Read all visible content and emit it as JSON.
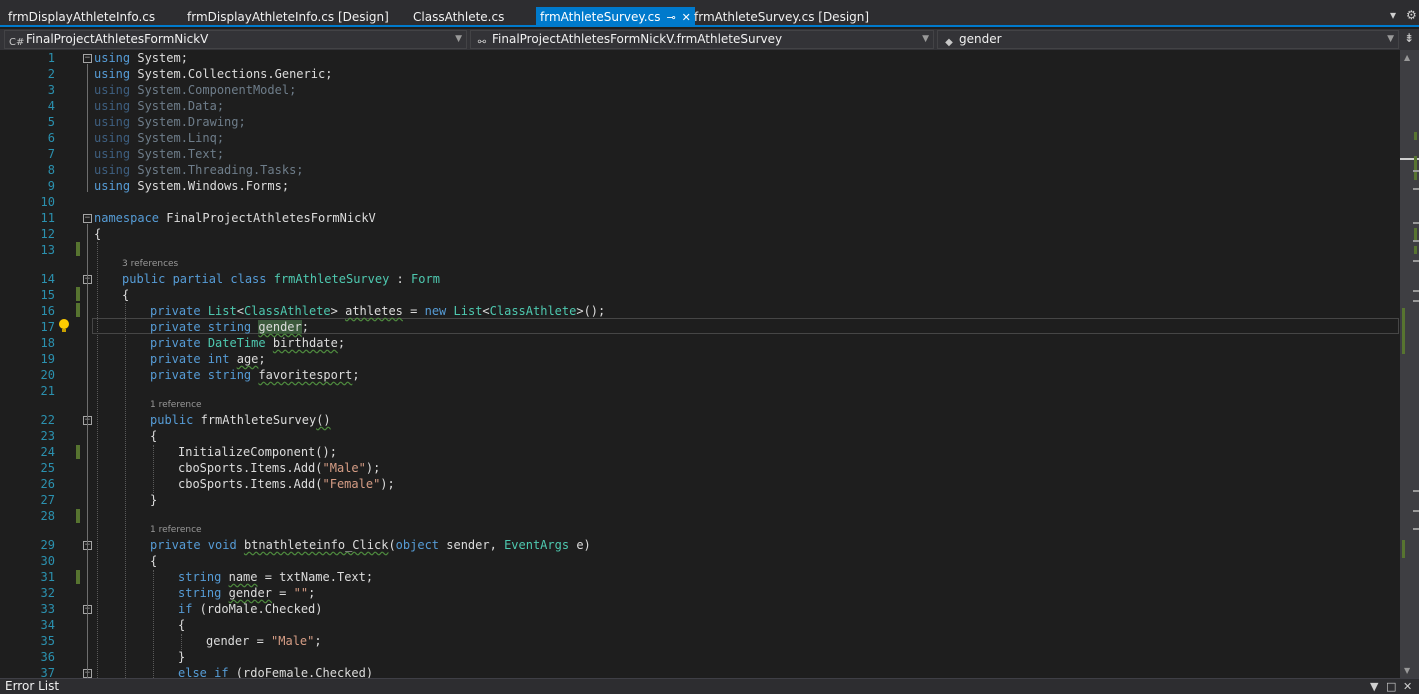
{
  "tabs": [
    {
      "label": "frmDisplayAthleteInfo.cs",
      "active": false
    },
    {
      "label": "frmDisplayAthleteInfo.cs [Design]",
      "active": false
    },
    {
      "label": "ClassAthlete.cs",
      "active": false
    },
    {
      "label": "frmAthleteSurvey.cs",
      "active": true
    },
    {
      "label": "frmAthleteSurvey.cs [Design]",
      "active": false
    }
  ],
  "nav": {
    "project": "FinalProjectAthletesFormNickV",
    "type": "FinalProjectAthletesFormNickV.frmAthleteSurvey",
    "member": "gender"
  },
  "code": {
    "l1": [
      "using",
      " System;"
    ],
    "l2": [
      "using",
      " System.Collections.Generic;"
    ],
    "l3": [
      "using",
      " System.ComponentModel;"
    ],
    "l4": [
      "using",
      " System.Data;"
    ],
    "l5": [
      "using",
      " System.Drawing;"
    ],
    "l6": [
      "using",
      " System.Linq;"
    ],
    "l7": [
      "using",
      " System.Text;"
    ],
    "l8": [
      "using",
      " System.Threading.Tasks;"
    ],
    "l9": [
      "using",
      " System.Windows.Forms;"
    ],
    "l11": [
      "namespace",
      " FinalProjectAthletesFormNickV"
    ],
    "l12": "{",
    "lens14": "3 references",
    "l14": [
      "public partial class",
      " ",
      "frmAthleteSurvey",
      " : ",
      "Form"
    ],
    "l15": "{",
    "l16": [
      "private",
      " ",
      "List",
      "<",
      "ClassAthlete",
      "> ",
      "athletes",
      " = ",
      "new",
      " ",
      "List",
      "<",
      "ClassAthlete",
      ">();"
    ],
    "l17": [
      "private string",
      " ",
      "gender",
      ";"
    ],
    "l18": [
      "private",
      " ",
      "DateTime",
      " ",
      "birthdate",
      ";"
    ],
    "l19": [
      "private int",
      " ",
      "age",
      ";"
    ],
    "l20": [
      "private string",
      " ",
      "favoritesport",
      ";"
    ],
    "lens22": "1 reference",
    "l22": [
      "public",
      " ",
      "frmAthleteSurvey",
      "()"
    ],
    "l23": "{",
    "l24": "InitializeComponent();",
    "l25": [
      "cboSports.Items.Add(",
      "\"Male\"",
      ");"
    ],
    "l26": [
      "cboSports.Items.Add(",
      "\"Female\"",
      ");"
    ],
    "l27": "}",
    "lens29": "1 reference",
    "l29": [
      "private void",
      " ",
      "btnathleteinfo_Click",
      "(",
      "object",
      " sender, ",
      "EventArgs",
      " e)"
    ],
    "l30": "{",
    "l31": [
      "string",
      " ",
      "name",
      " = txtName.Text;"
    ],
    "l32": [
      "string",
      " ",
      "gender",
      " = ",
      "\"\"",
      ";"
    ],
    "l33": [
      "if",
      " (rdoMale.Checked)"
    ],
    "l34": "{",
    "l35": [
      "gender = ",
      "\"Male\"",
      ";"
    ],
    "l36": "}",
    "l37": [
      "else if",
      " (rdoFemale.Checked)"
    ]
  },
  "line_numbers": [
    "1",
    "2",
    "3",
    "4",
    "5",
    "6",
    "7",
    "8",
    "9",
    "10",
    "11",
    "12",
    "13",
    "14",
    "15",
    "16",
    "17",
    "18",
    "19",
    "20",
    "21",
    "22",
    "23",
    "24",
    "25",
    "26",
    "27",
    "28",
    "29",
    "30",
    "31",
    "32",
    "33",
    "34",
    "35",
    "36",
    "37"
  ],
  "error_list": {
    "label": "Error List"
  },
  "colors": {
    "accent": "#007acc",
    "keyword": "#569cd6",
    "type": "#4ec9b0",
    "string": "#d69d85",
    "line_number": "#2b91af"
  }
}
